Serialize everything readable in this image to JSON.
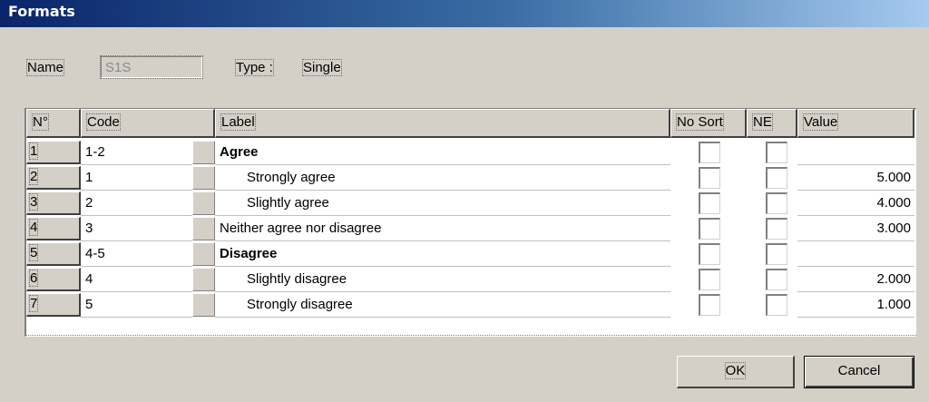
{
  "window": {
    "title": "Formats"
  },
  "form": {
    "name_label": "Name",
    "name_value": "S1S",
    "type_label": "Type :",
    "type_value": "Single"
  },
  "table": {
    "columns": [
      "N°",
      "Code",
      "Label",
      "No Sort",
      "NE",
      "Value"
    ],
    "rows": [
      {
        "num": "1",
        "code": "1-2",
        "label": "Agree",
        "bold": true,
        "indent": false,
        "value": ""
      },
      {
        "num": "2",
        "code": "1",
        "label": "Strongly agree",
        "bold": false,
        "indent": true,
        "value": "5.000"
      },
      {
        "num": "3",
        "code": "2",
        "label": "Slightly agree",
        "bold": false,
        "indent": true,
        "value": "4.000"
      },
      {
        "num": "4",
        "code": "3",
        "label": "Neither agree nor disagree",
        "bold": false,
        "indent": false,
        "value": "3.000"
      },
      {
        "num": "5",
        "code": "4-5",
        "label": "Disagree",
        "bold": true,
        "indent": false,
        "value": ""
      },
      {
        "num": "6",
        "code": "4",
        "label": "Slightly disagree",
        "bold": false,
        "indent": true,
        "value": "2.000"
      },
      {
        "num": "7",
        "code": "5",
        "label": "Strongly disagree",
        "bold": false,
        "indent": true,
        "value": "1.000"
      }
    ]
  },
  "buttons": {
    "ok": "OK",
    "cancel": "Cancel"
  }
}
